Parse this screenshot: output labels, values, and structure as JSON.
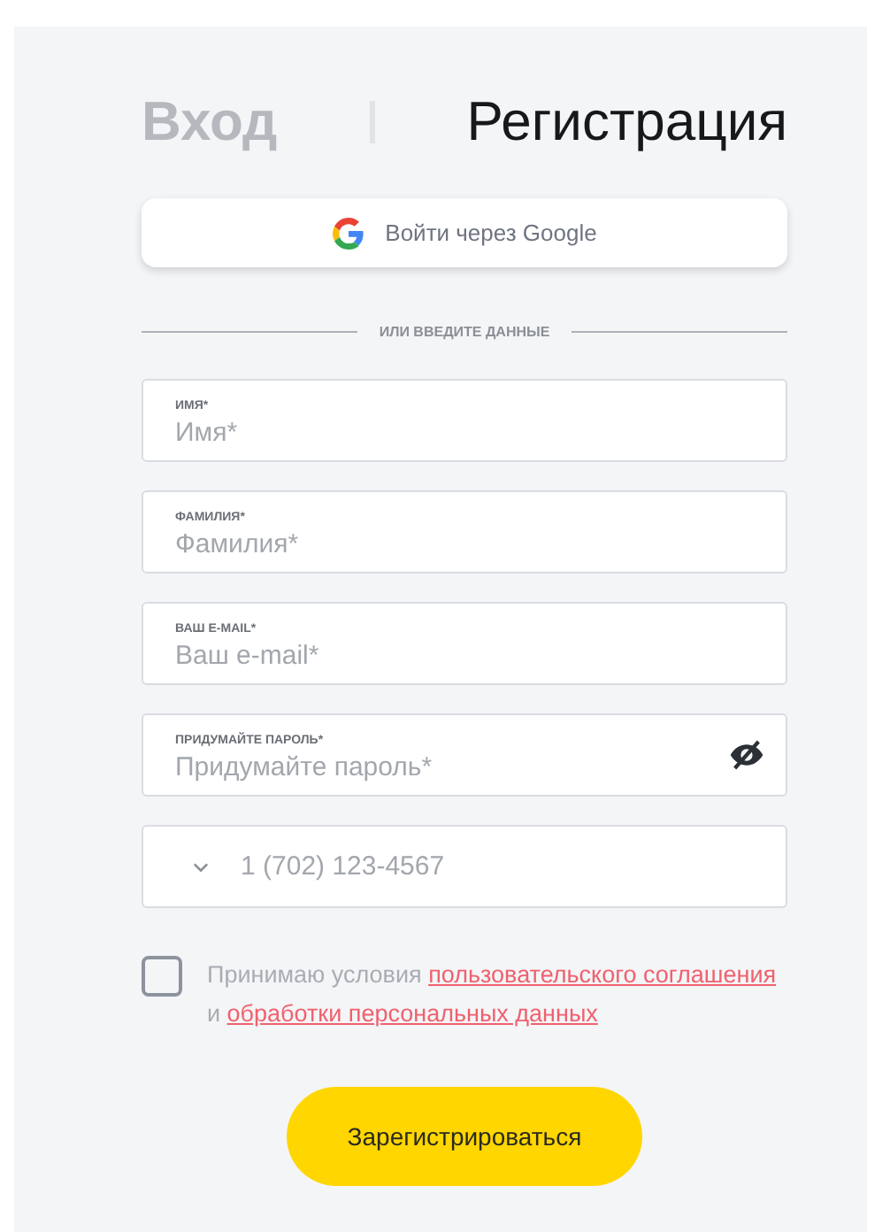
{
  "tabs": [
    {
      "label": "Вход",
      "selected": false
    },
    {
      "label": "Регистрация",
      "selected": true
    }
  ],
  "google_button": {
    "label": "Войти через Google"
  },
  "divider": {
    "label": "ИЛИ ВВЕДИТЕ ДАННЫЕ"
  },
  "fields": [
    {
      "kind": "text",
      "label": "ИМЯ*",
      "placeholder": "Имя*"
    },
    {
      "kind": "text",
      "label": "ФАМИЛИЯ*",
      "placeholder": "Фамилия*"
    },
    {
      "kind": "text",
      "label": "ВАШ E-MAIL*",
      "placeholder": "Ваш e-mail*"
    },
    {
      "kind": "password",
      "label": "ПРИДУМАЙТЕ ПАРОЛЬ*",
      "placeholder": "Придумайте пароль*"
    },
    {
      "kind": "phone",
      "placeholder": "1 (702) 123-4567"
    }
  ],
  "consent": {
    "checked": false,
    "parts": [
      {
        "kind": "text",
        "text": "Принимаю условия "
      },
      {
        "kind": "link",
        "text": "пользовательского соглашения"
      },
      {
        "kind": "text",
        "text": " и "
      },
      {
        "kind": "link",
        "text": "обработки персональных данных"
      }
    ]
  },
  "submit_button": {
    "label": "Зарегистрироваться"
  }
}
